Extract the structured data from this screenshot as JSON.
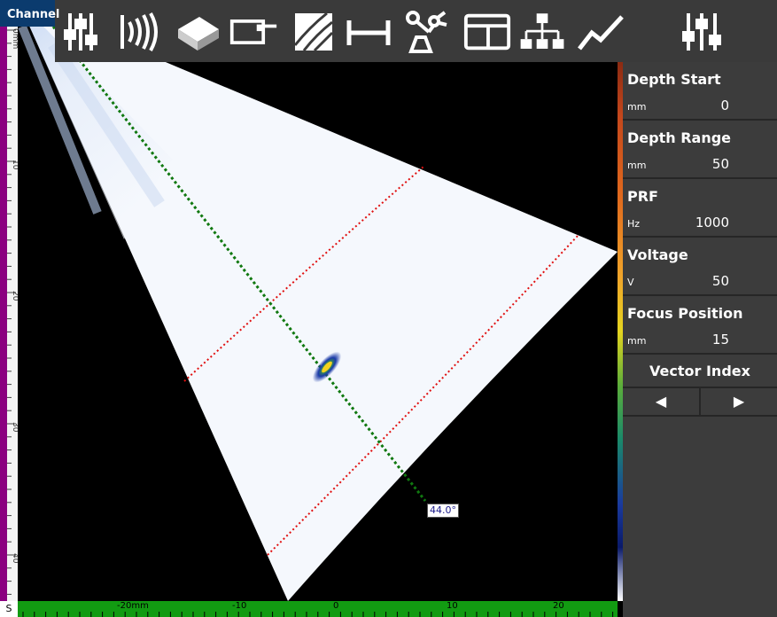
{
  "channel_tab": "Channel",
  "toolbar": {
    "icons": [
      "sliders-icon",
      "pulse-icon",
      "probe-block-icon",
      "probe-icon",
      "wedge-icon",
      "measure-icon",
      "robot-arm-icon",
      "layout-icon",
      "tree-icon",
      "graph-icon",
      "settings-sliders-icon"
    ]
  },
  "left_ruler": {
    "unit": "mm",
    "labels": [
      "0mm",
      "10",
      "20",
      "30",
      "40"
    ]
  },
  "bottom_ruler": {
    "corner": "S",
    "labels": [
      "-20mm",
      "-10",
      "0",
      "10",
      "20"
    ]
  },
  "scan": {
    "angle_label": "44.0°"
  },
  "params": [
    {
      "label": "Depth Start",
      "unit": "mm",
      "value": "0"
    },
    {
      "label": "Depth Range",
      "unit": "mm",
      "value": "50"
    },
    {
      "label": "PRF",
      "unit": "Hz",
      "value": "1000"
    },
    {
      "label": "Voltage",
      "unit": "V",
      "value": "50"
    },
    {
      "label": "Focus Position",
      "unit": "mm",
      "value": "15"
    }
  ],
  "vector_index": {
    "title": "Vector Index",
    "prev": "◀",
    "next": "▶"
  },
  "colors": {
    "toolbar_bg": "#3a3a3a",
    "panel_bg": "#3c3c3c",
    "ruler_bottom": "#129b12",
    "ruler_left_strip": "#8b0080"
  }
}
